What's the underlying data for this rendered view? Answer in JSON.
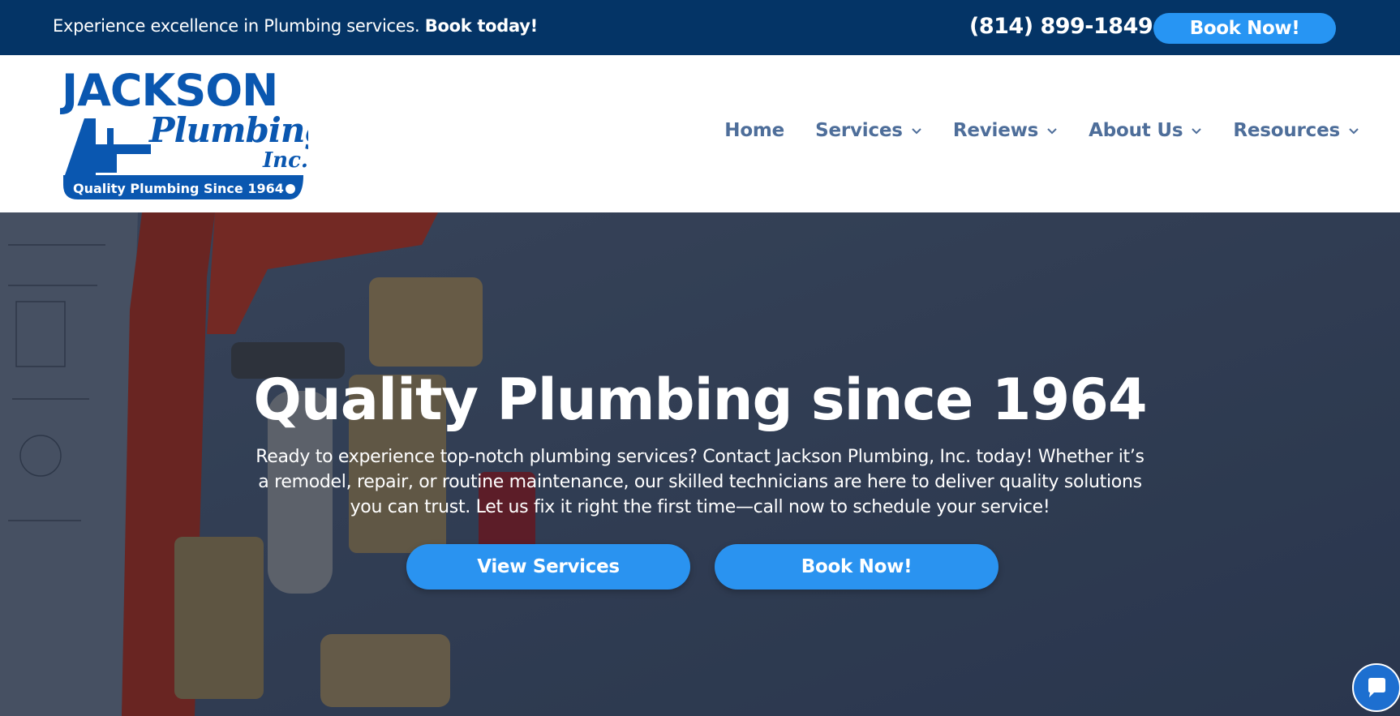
{
  "topbar": {
    "promo_text": "Experience excellence in Plumbing services.",
    "promo_bold": "Book today!",
    "phone": "(814) 899-1849",
    "book_label": "Book Now!"
  },
  "logo": {
    "line1": "JACKSON",
    "line2": "Plumbing",
    "line3": "Inc.",
    "tagline": "Quality Plumbing Since 1964"
  },
  "nav": {
    "items": [
      {
        "label": "Home",
        "dropdown": false
      },
      {
        "label": "Services",
        "dropdown": true
      },
      {
        "label": "Reviews",
        "dropdown": true
      },
      {
        "label": "About Us",
        "dropdown": true
      },
      {
        "label": "Resources",
        "dropdown": true
      }
    ]
  },
  "hero": {
    "title": "Quality Plumbing since 1964",
    "text": "Ready to experience top-notch plumbing services? Contact Jackson Plumbing, Inc. today! Whether it’s a remodel, repair, or routine maintenance, our skilled technicians are here to deliver quality solutions you can trust. Let us fix it right the first time—call now to schedule your service!",
    "btn_services": "View Services",
    "btn_book": "Book Now!"
  },
  "colors": {
    "topbar": "#043466",
    "accent": "#2795f3",
    "nav_text": "#4e6e9a",
    "logo_blue": "#0a57b0"
  },
  "chat": {
    "icon": "chat-icon"
  }
}
